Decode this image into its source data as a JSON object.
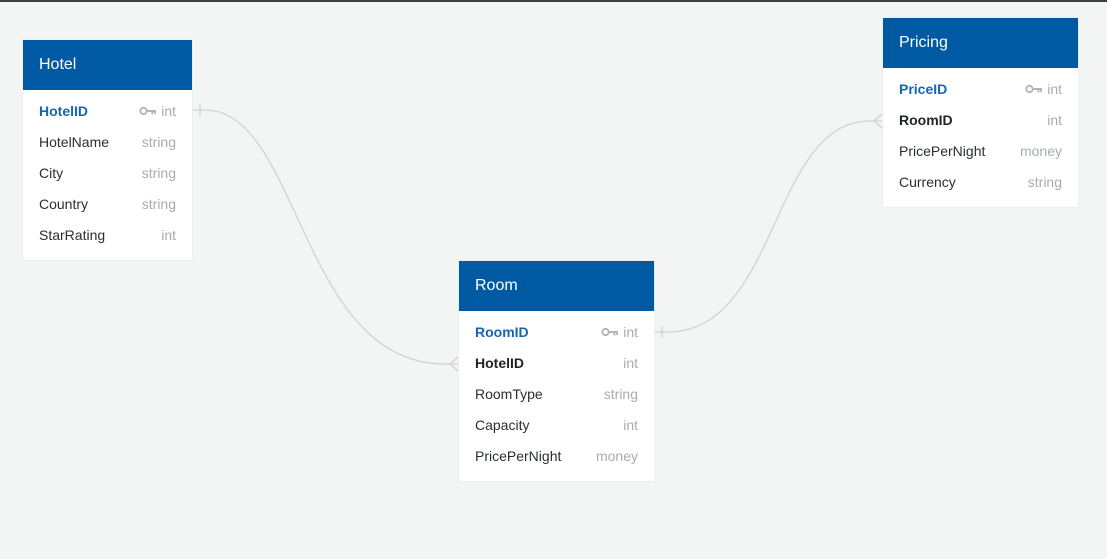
{
  "tables": {
    "hotel": {
      "title": "Hotel",
      "fields": [
        {
          "name": "HotelID",
          "type": "int",
          "pk": true,
          "fk": false
        },
        {
          "name": "HotelName",
          "type": "string",
          "pk": false,
          "fk": false
        },
        {
          "name": "City",
          "type": "string",
          "pk": false,
          "fk": false
        },
        {
          "name": "Country",
          "type": "string",
          "pk": false,
          "fk": false
        },
        {
          "name": "StarRating",
          "type": "int",
          "pk": false,
          "fk": false
        }
      ]
    },
    "room": {
      "title": "Room",
      "fields": [
        {
          "name": "RoomID",
          "type": "int",
          "pk": true,
          "fk": false
        },
        {
          "name": "HotelID",
          "type": "int",
          "pk": false,
          "fk": true
        },
        {
          "name": "RoomType",
          "type": "string",
          "pk": false,
          "fk": false
        },
        {
          "name": "Capacity",
          "type": "int",
          "pk": false,
          "fk": false
        },
        {
          "name": "PricePerNight",
          "type": "money",
          "pk": false,
          "fk": false
        }
      ]
    },
    "pricing": {
      "title": "Pricing",
      "fields": [
        {
          "name": "PriceID",
          "type": "int",
          "pk": true,
          "fk": false
        },
        {
          "name": "RoomID",
          "type": "int",
          "pk": false,
          "fk": true
        },
        {
          "name": "PricePerNight",
          "type": "money",
          "pk": false,
          "fk": false
        },
        {
          "name": "Currency",
          "type": "string",
          "pk": false,
          "fk": false
        }
      ]
    }
  },
  "relationships": [
    {
      "from": "Hotel.HotelID",
      "to": "Room.HotelID",
      "from_end": "one",
      "to_end": "many"
    },
    {
      "from": "Room.RoomID",
      "to": "Pricing.RoomID",
      "from_end": "one",
      "to_end": "many"
    }
  ],
  "colors": {
    "header": "#005aa3",
    "primary_key": "#1565b3",
    "type_text": "#a8acb0",
    "connector": "#cfd3d6",
    "background": "#f3f4f4"
  },
  "icons": {
    "primary_key": "key-icon"
  }
}
